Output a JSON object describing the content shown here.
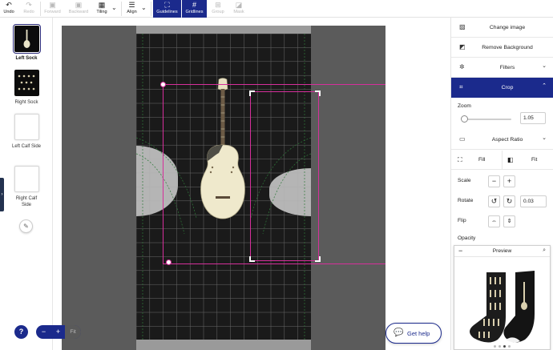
{
  "toolbar": {
    "undo": "Undo",
    "redo": "Redo",
    "forward": "Forward",
    "backward": "Backward",
    "tiling": "Tiling",
    "align": "Align",
    "guidelines": "Guidelines",
    "gridlines": "Gridlines",
    "group": "Group",
    "mask": "Mask"
  },
  "products": [
    {
      "label": "Left Sock",
      "selected": true
    },
    {
      "label": "Right Sock",
      "selected": false
    },
    {
      "label": "Left Calf Side",
      "selected": false
    },
    {
      "label": "Right Calf Side",
      "selected": false
    }
  ],
  "right_panel": {
    "change_image": "Change image",
    "remove_background": "Remove Background",
    "filters": "Filters",
    "crop": "Crop",
    "zoom_label": "Zoom",
    "zoom_value": "1.05",
    "zoom_fraction": 0.05,
    "aspect_ratio": "Aspect Ratio",
    "fill": "Fill",
    "fit": "Fit",
    "scale": "Scale",
    "rotate": "Rotate",
    "rotate_value": "0.03",
    "flip": "Flip",
    "opacity": "Opacity"
  },
  "preview": {
    "title": "Preview"
  },
  "bottom": {
    "help_glyph": "?",
    "zoom_minus": "−",
    "zoom_plus": "+",
    "zoom_fit": "Fit",
    "get_help": "Get help"
  },
  "colors": {
    "accent": "#1b2a8c",
    "selection": "#d62f9b",
    "canvas": "#5b5b5b"
  }
}
